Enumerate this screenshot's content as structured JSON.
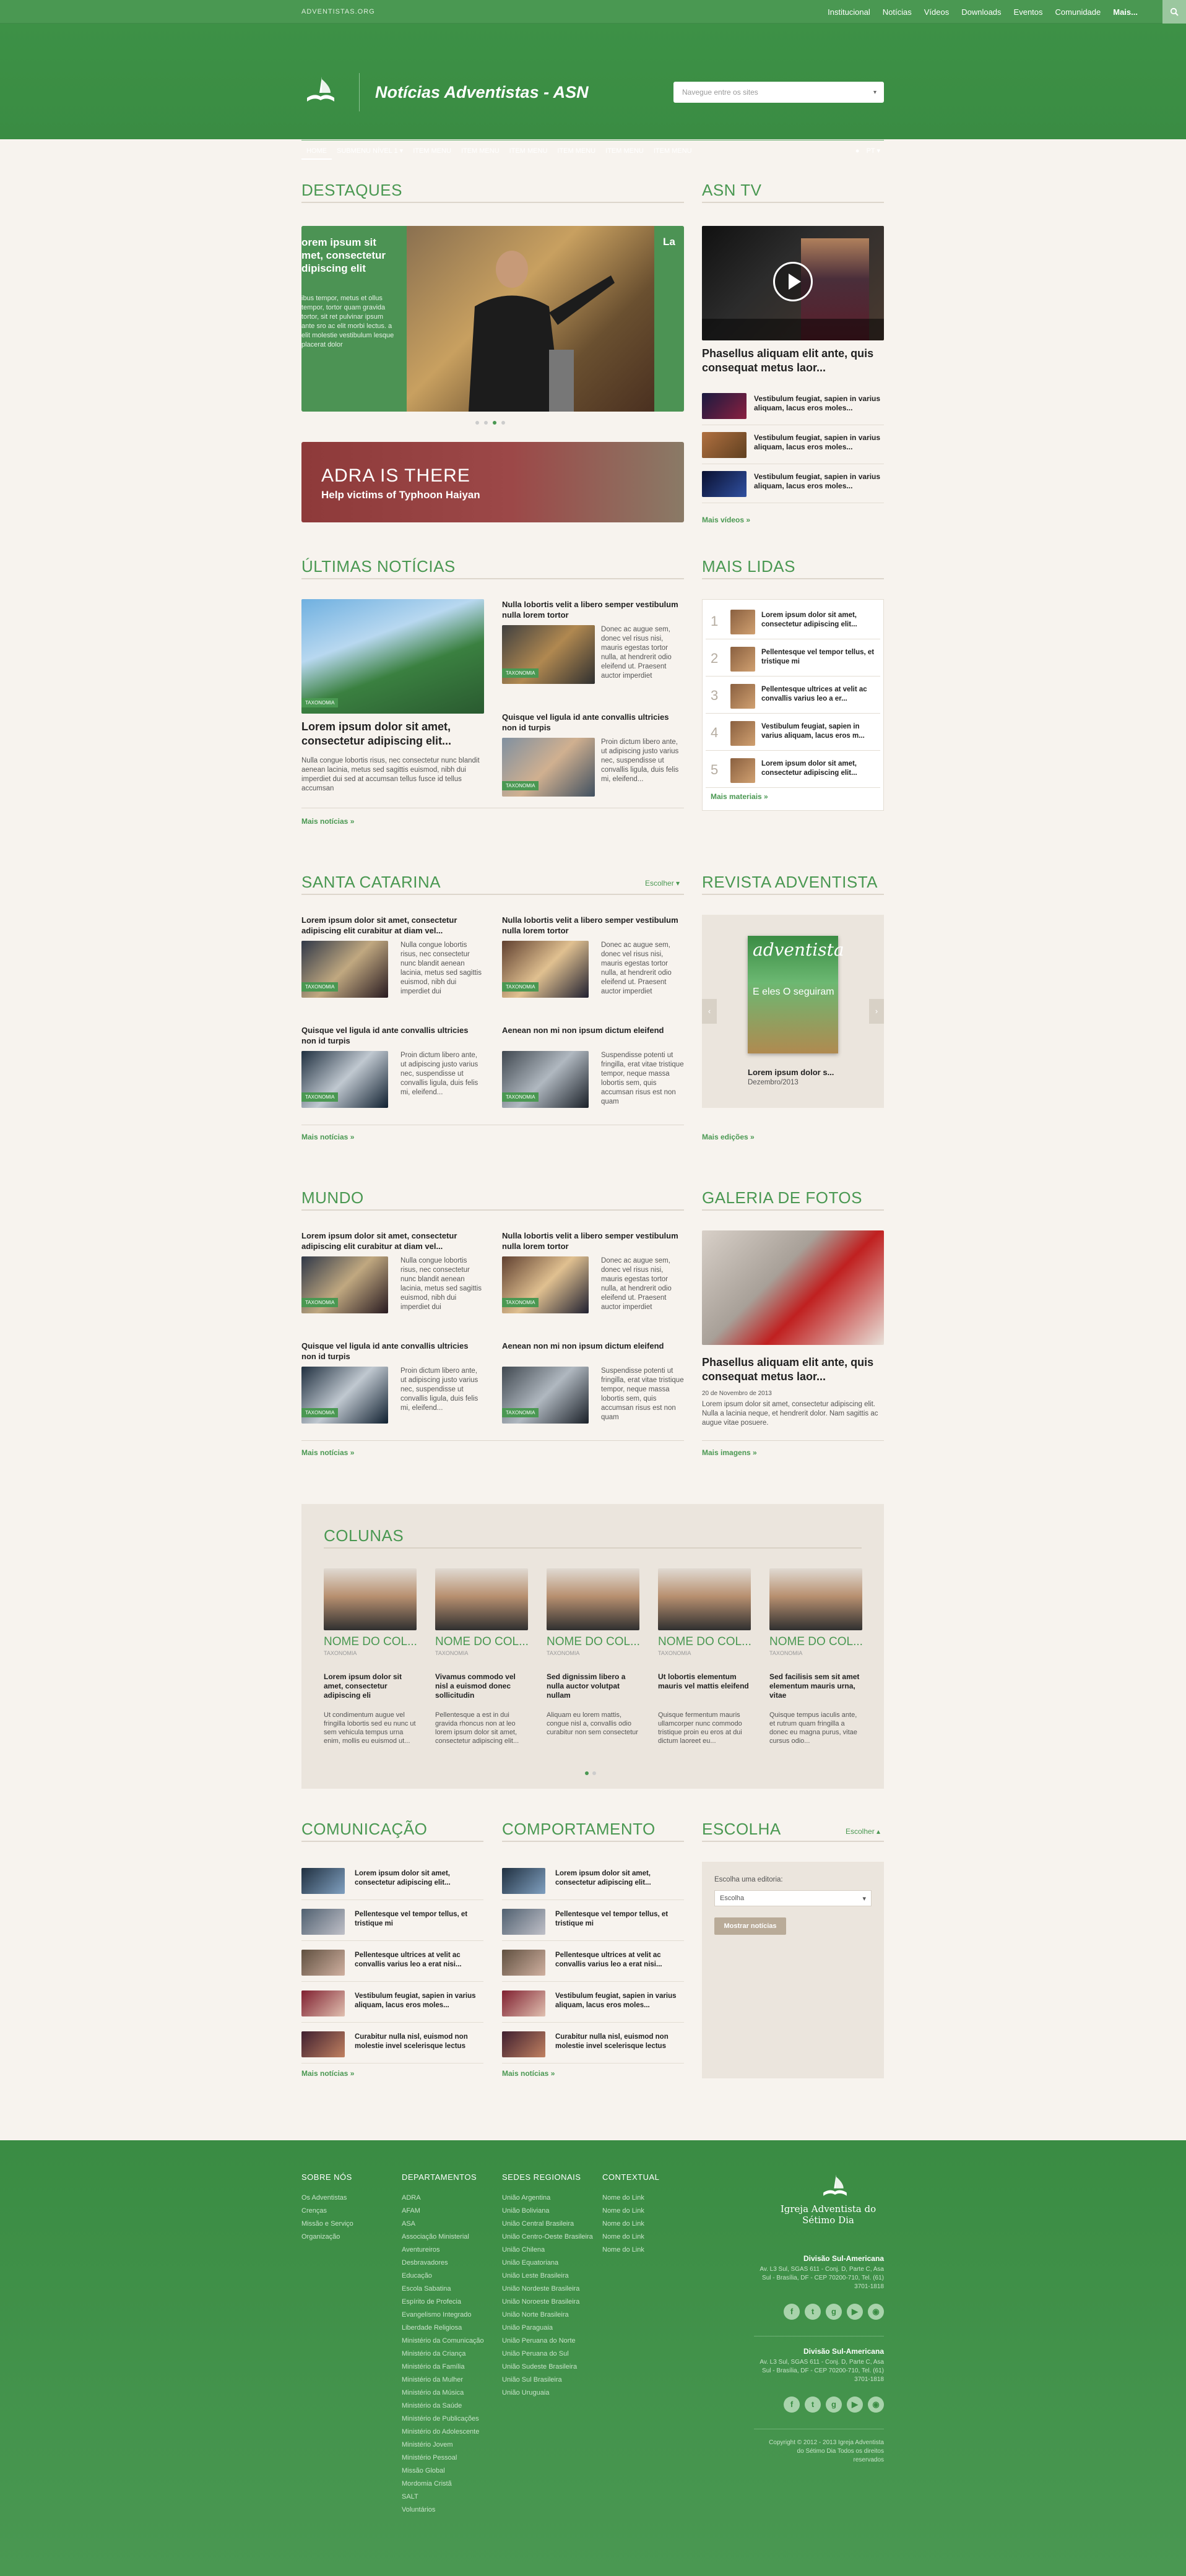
{
  "topbar": {
    "site": "ADVENTISTAS.ORG",
    "links": [
      "Institucional",
      "Notícias",
      "Vídeos",
      "Downloads",
      "Eventos",
      "Comunidade",
      "Mais..."
    ]
  },
  "header": {
    "title": "Notícias Adventistas - ASN",
    "search_placeholder": "Navegue entre os sites"
  },
  "nav": {
    "items": [
      "HOME",
      "SUBMENU NÍVEL 1",
      "ITEM MENU",
      "ITEM MENU",
      "ITEM MENU",
      "ITEM MENU",
      "ITEM MENU",
      "ITEM MENU"
    ],
    "lang": "PT"
  },
  "destaques": {
    "title": "DESTAQUES",
    "left_text_title": "orem ipsum sit met, consectetur dipiscing elit",
    "left_text_body": "ibus tempor, metus et ollus tempor, tortor quam gravida tortor, sit ret pulvinar ipsum ante sro ac elit morbi lectus. a elit molestie vestibulum lesque placerat dolor",
    "right_letter": "La"
  },
  "adra": {
    "title": "ADRA IS THERE",
    "subtitle": "Help victims of Typhoon Haiyan"
  },
  "asntv": {
    "title": "ASN TV",
    "main_caption": "Phasellus aliquam elit ante, quis consequat metus laor...",
    "items": [
      "Vestibulum feugiat, sapien in varius aliquam, lacus eros moles...",
      "Vestibulum feugiat, sapien in varius aliquam, lacus eros moles...",
      "Vestibulum feugiat, sapien in varius aliquam, lacus eros moles..."
    ],
    "more": "Mais vídeos »"
  },
  "ultimas": {
    "title": "ÚLTIMAS NOTÍCIAS",
    "main_title": "Lorem ipsum dolor sit amet, consectetur adipiscing elit...",
    "main_body": "Nulla congue lobortis risus, nec consectetur nunc blandit aenean lacinia, metus sed sagittis euismod, nibh dui imperdiet dui sed at accumsan tellus fusce id tellus accumsan",
    "side": [
      {
        "title": "Nulla lobortis velit a libero semper vestibulum nulla lorem tortor",
        "body": "Donec ac augue sem, donec vel risus nisi, mauris egestas tortor nulla, at hendrerit odio eleifend ut. Praesent auctor imperdiet"
      },
      {
        "title": "Quisque vel ligula id ante convallis ultricies non id turpis",
        "body": "Proin dictum libero ante, ut adipiscing justo varius nec, suspendisse ut convallis ligula, duis felis mi, eleifend..."
      }
    ],
    "tag": "TAXONOMIA",
    "more": "Mais notícias »"
  },
  "maislidas": {
    "title": "MAIS LIDAS",
    "items": [
      "Lorem ipsum dolor sit amet, consectetur adipiscing elit...",
      "Pellentesque vel tempor tellus, et tristique mi",
      "Pellentesque ultrices at velit ac convallis varius leo a er...",
      "Vestibulum feugiat, sapien in varius aliquam, lacus eros m...",
      "Lorem ipsum dolor sit amet, consectetur adipiscing elit..."
    ],
    "more": "Mais materiais »"
  },
  "santacatarina": {
    "title": "SANTA CATARINA",
    "choose": "Escolher",
    "items": [
      {
        "title": "Lorem ipsum dolor sit amet, consectetur adipiscing elit curabitur at diam vel...",
        "body": "Nulla congue lobortis risus, nec consectetur nunc blandit aenean lacinia, metus sed sagittis euismod, nibh dui imperdiet dui"
      },
      {
        "title": "Nulla lobortis velit a libero semper vestibulum nulla lorem tortor",
        "body": "Donec ac augue sem, donec vel risus nisi, mauris egestas tortor nulla, at hendrerit odio eleifend ut. Praesent auctor imperdiet"
      },
      {
        "title": "Quisque vel ligula id ante convallis ultricies non id turpis",
        "body": "Proin dictum libero ante, ut adipiscing justo varius nec, suspendisse ut convallis ligula, duis felis mi, eleifend..."
      },
      {
        "title": "Aenean non mi non ipsum dictum eleifend",
        "body": "Suspendisse potenti ut fringilla, erat vitae tristique tempor, neque massa lobortis sem, quis accumsan risus est non quam"
      }
    ],
    "more": "Mais notícias »"
  },
  "revista": {
    "title": "REVISTA ADVENTISTA",
    "cover_title": "adventista",
    "cover_sub": "E eles O seguiram",
    "caption": "Lorem ipsum dolor s...",
    "date": "Dezembro/2013",
    "more": "Mais edições »"
  },
  "mundo": {
    "title": "MUNDO",
    "items": [
      {
        "title": "Lorem ipsum dolor sit amet, consectetur adipiscing elit curabitur at diam vel...",
        "body": "Nulla congue lobortis risus, nec consectetur nunc blandit aenean lacinia, metus sed sagittis euismod, nibh dui imperdiet dui"
      },
      {
        "title": "Nulla lobortis velit a libero semper vestibulum nulla lorem tortor",
        "body": "Donec ac augue sem, donec vel risus nisi, mauris egestas tortor nulla, at hendrerit odio eleifend ut. Praesent auctor imperdiet"
      },
      {
        "title": "Quisque vel ligula id ante convallis ultricies non id turpis",
        "body": "Proin dictum libero ante, ut adipiscing justo varius nec, suspendisse ut convallis ligula, duis felis mi, eleifend..."
      },
      {
        "title": "Aenean non mi non ipsum dictum eleifend",
        "body": "Suspendisse potenti ut fringilla, erat vitae tristique tempor, neque massa lobortis sem, quis accumsan risus est non quam"
      }
    ],
    "more": "Mais notícias »"
  },
  "galeria": {
    "title": "GALERIA DE FOTOS",
    "caption": "Phasellus aliquam elit ante, quis consequat metus laor...",
    "date": "20 de Novembro de 2013",
    "body": "Lorem ipsum dolor sit amet, consectetur adipiscing elit. Nulla a lacinia neque, et hendrerit dolor. Nam sagittis ac augue vitae posuere.",
    "more": "Mais imagens »"
  },
  "colunas": {
    "title": "COLUNAS",
    "items": [
      {
        "name": "NOME DO COL...",
        "tax": "TAXONOMIA",
        "title": "Lorem ipsum dolor sit amet, consectetur adipiscing eli",
        "body": "Ut condimentum augue vel fringilla lobortis sed eu nunc ut sem vehicula tempus urna enim, mollis eu euismod ut..."
      },
      {
        "name": "NOME DO COL...",
        "tax": "TAXONOMIA",
        "title": "Vivamus commodo vel nisl a euismod donec sollicitudin",
        "body": "Pellentesque a est in dui gravida rhoncus non at leo lorem ipsum dolor sit amet, consectetur adipiscing elit..."
      },
      {
        "name": "NOME DO COL...",
        "tax": "TAXONOMIA",
        "title": "Sed dignissim libero a nulla auctor volutpat nullam",
        "body": "Aliquam eu lorem mattis, congue nisl a, convallis odio curabitur non sem consectetur"
      },
      {
        "name": "NOME DO COL...",
        "tax": "TAXONOMIA",
        "title": "Ut lobortis elementum mauris vel mattis eleifend",
        "body": "Quisque fermentum mauris ullamcorper nunc commodo tristique proin eu eros at dui dictum laoreet eu..."
      },
      {
        "name": "NOME DO COL...",
        "tax": "TAXONOMIA",
        "title": "Sed facilisis sem sit amet elementum mauris urna, vitae",
        "body": "Quisque tempus iaculis ante, et rutrum quam fringilla a donec eu magna purus, vitae cursus odio..."
      }
    ]
  },
  "comunicacao": {
    "title": "COMUNICAÇÃO",
    "items": [
      "Lorem ipsum dolor sit amet, consectetur adipiscing elit...",
      "Pellentesque vel tempor tellus, et tristique mi",
      "Pellentesque ultrices at velit ac convallis varius leo a erat nisi...",
      "Vestibulum feugiat, sapien in varius aliquam, lacus eros moles...",
      "Curabitur nulla nisl, euismod non molestie invel scelerisque lectus"
    ],
    "more": "Mais notícias »"
  },
  "comportamento": {
    "title": "COMPORTAMENTO",
    "items": [
      "Lorem ipsum dolor sit amet, consectetur adipiscing elit...",
      "Pellentesque vel tempor tellus, et tristique mi",
      "Pellentesque ultrices at velit ac convallis varius leo a erat nisi...",
      "Vestibulum feugiat, sapien in varius aliquam, lacus eros moles...",
      "Curabitur nulla nisl, euismod non molestie invel scelerisque lectus"
    ],
    "more": "Mais notícias »"
  },
  "escolha": {
    "title": "ESCOLHA",
    "choose": "Escolher",
    "label": "Escolha uma editoria:",
    "select_value": "Escolha",
    "button": "Mostrar notícias"
  },
  "footer": {
    "sobre": {
      "title": "SOBRE NÓS",
      "items": [
        "Os Adventistas",
        "Crenças",
        "Missão e Serviço",
        "Organização"
      ]
    },
    "departamentos": {
      "title": "DEPARTAMENTOS",
      "items": [
        "ADRA",
        "AFAM",
        "ASA",
        "Associação Ministerial",
        "Aventureiros",
        "Desbravadores",
        "Educação",
        "Escola Sabatina",
        "Espírito de Profecia",
        "Evangelismo Integrado",
        "Liberdade Religiosa",
        "Ministério da Comunicação",
        "Ministério da Criança",
        "Ministério da Família",
        "Ministério da Mulher",
        "Ministério da Música",
        "Ministério da Saúde",
        "Ministério de Publicações",
        "Ministério do Adolescente",
        "Ministério Jovem",
        "Ministério Pessoal",
        "Missão Global",
        "Mordomia Cristã",
        "SALT",
        "Voluntários"
      ]
    },
    "sedes": {
      "title": "SEDES REGIONAIS",
      "items": [
        "União Argentina",
        "União Boliviana",
        "União Central Brasileira",
        "União Centro-Oeste Brasileira",
        "União Chilena",
        "União Equatoriana",
        "União Leste Brasileira",
        "União Nordeste Brasileira",
        "União Noroeste Brasileira",
        "União Norte Brasileira",
        "União Paraguaia",
        "União Peruana do Norte",
        "União Peruana do Sul",
        "União Sudeste Brasileira",
        "União Sul Brasileira",
        "União Uruguaia"
      ]
    },
    "contextual": {
      "title": "CONTEXTUAL",
      "items": [
        "Nome do Link",
        "Nome do Link",
        "Nome do Link",
        "Nome do Link",
        "Nome do Link"
      ]
    },
    "brand": "Igreja Adventista do Sétimo Dia",
    "addr1_title": "Divisão Sul-Americana",
    "addr1": "Av. L3 Sul, SGAS 611 - Conj. D, Parte C, Asa Sul - Brasília, DF - CEP 70200-710, Tel. (61) 3701-1818",
    "addr2_title": "Divisão Sul-Americana",
    "addr2": "Av. L3 Sul, SGAS 611 - Conj. D, Parte C, Asa Sul - Brasília, DF - CEP 70200-710, Tel. (61) 3701-1818",
    "copyright": "Copyright © 2012 - 2013 Igreja Adventista do Sétimo Dia Todos os direitos reservados",
    "social": [
      "facebook-icon",
      "twitter-icon",
      "googleplus-icon",
      "youtube-icon",
      "rss-icon"
    ]
  },
  "colors": {
    "brand": "#4a9852",
    "bg": "#f7f3ee",
    "panel": "#ebe5dd"
  }
}
